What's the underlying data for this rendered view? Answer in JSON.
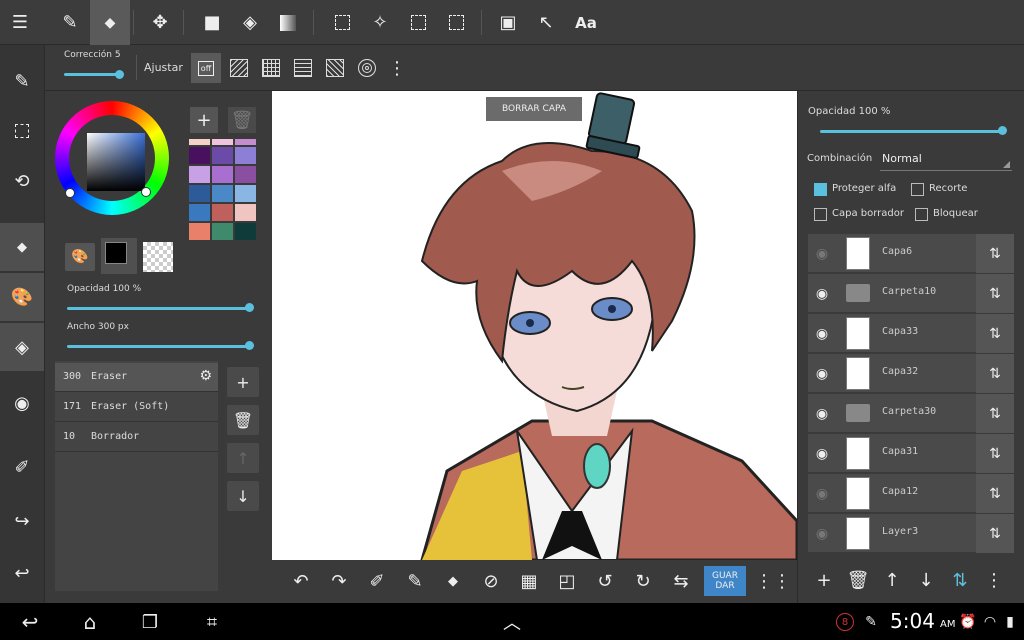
{
  "toolbar": {
    "tools": [
      {
        "name": "pen-icon",
        "glyph": "✎"
      },
      {
        "name": "eraser-icon",
        "glyph": "▰"
      },
      {
        "name": "move-icon",
        "glyph": "✥"
      },
      {
        "name": "fill-rect-icon",
        "glyph": "■"
      },
      {
        "name": "bucket-icon",
        "glyph": "◈"
      },
      {
        "name": "gradient-icon",
        "glyph": "▦"
      },
      {
        "name": "select-rect-icon",
        "glyph": "⬚"
      },
      {
        "name": "magic-wand-icon",
        "glyph": "✧"
      },
      {
        "name": "select-pen-icon",
        "glyph": "⬚"
      },
      {
        "name": "select-eraser-icon",
        "glyph": "⬚"
      },
      {
        "name": "layer-adjust-icon",
        "glyph": "▣"
      },
      {
        "name": "pointer-icon",
        "glyph": "↖"
      }
    ],
    "text_tool_label": "Aa"
  },
  "subbar": {
    "correction_label": "Corrección 5",
    "correction_value": 5,
    "snap_label": "Ajustar",
    "snap_off_label": "off"
  },
  "left_panel": {
    "opacity_label": "Opacidad 100 %",
    "opacity_value": 100,
    "width_label": "Ancho 300 px",
    "width_value": 300,
    "palette_colors": [
      "#f3d0c8",
      "#f0c3dc",
      "#c78bd0",
      "#4a1060",
      "#6b4aa8",
      "#8e7fd6",
      "#c8a0e6",
      "#a86fd0",
      "#8a4fa0",
      "#2d5b9a",
      "#4a88c8",
      "#8ab6e6",
      "#3a78c0",
      "#c0605c",
      "#f0c4c0",
      "#e8806a",
      "#3e8a6a",
      "#0f3c3a"
    ],
    "brushes": [
      {
        "size": "300",
        "name": "Eraser"
      },
      {
        "size": "171",
        "name": "Eraser (Soft)"
      },
      {
        "size": "10",
        "name": "Borrador"
      }
    ]
  },
  "canvas": {
    "clear_layer_label": "BORRAR CAPA"
  },
  "bottom_bar": {
    "save_label": "GUAR DAR"
  },
  "right_panel": {
    "opacity_label": "Opacidad 100 %",
    "opacity_value": 100,
    "blend_label": "Combinación",
    "blend_value": "Normal",
    "checkboxes": {
      "protect_alpha": "Proteger alfa",
      "clipping": "Recorte",
      "eraser_layer": "Capa borrador",
      "lock": "Bloquear"
    },
    "layers": [
      {
        "name": "Capa6",
        "type": "layer",
        "visible": false
      },
      {
        "name": "Carpeta10",
        "type": "folder",
        "visible": true
      },
      {
        "name": "Capa33",
        "type": "layer",
        "visible": true
      },
      {
        "name": "Capa32",
        "type": "layer",
        "visible": true
      },
      {
        "name": "Carpeta30",
        "type": "folder",
        "visible": true
      },
      {
        "name": "Capa31",
        "type": "layer",
        "visible": true
      },
      {
        "name": "Capa12",
        "type": "layer",
        "visible": false
      },
      {
        "name": "Layer3",
        "type": "layer",
        "visible": false
      }
    ]
  },
  "system": {
    "time": "5:04",
    "ampm": "AM",
    "notification_count": "8"
  }
}
